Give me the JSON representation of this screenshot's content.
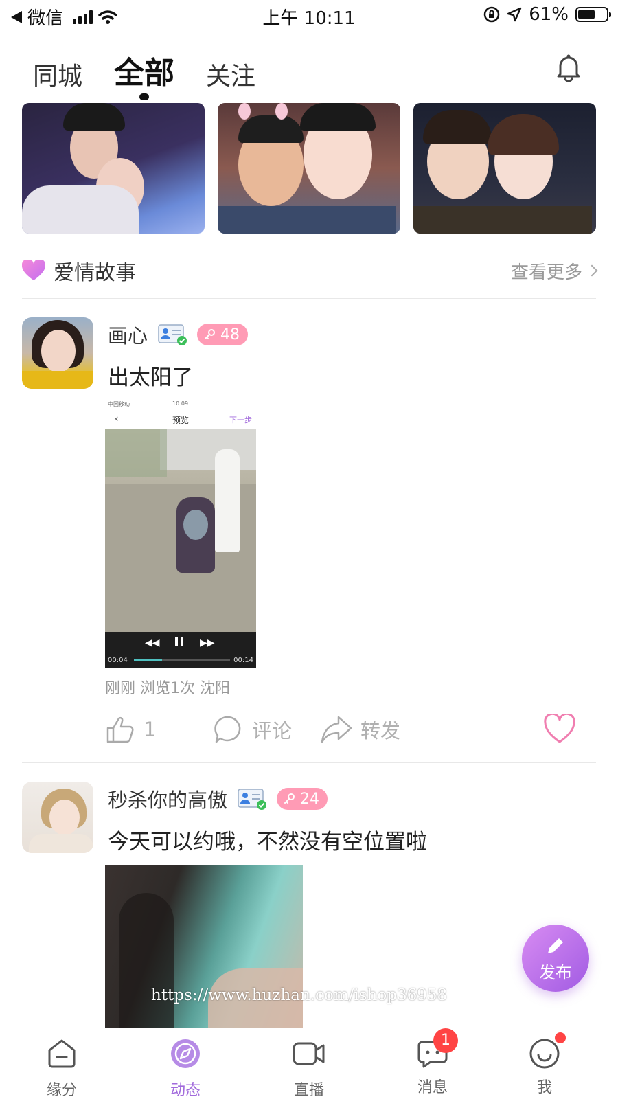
{
  "status_bar": {
    "back_app": "微信",
    "time": "上午 10:11",
    "battery_percent": "61%",
    "battery_level": 0.61
  },
  "tabs": [
    {
      "label": "同城",
      "active": false
    },
    {
      "label": "全部",
      "active": true
    },
    {
      "label": "关注",
      "active": false
    }
  ],
  "love_section": {
    "title": "爱情故事",
    "more_label": "查看更多"
  },
  "posts": [
    {
      "name": "画心",
      "level": "48",
      "text": "出太阳了",
      "video": {
        "title": "预览",
        "next": "下一步",
        "carrier": "中国移动",
        "clock": "10:09",
        "elapsed": "00:04",
        "duration": "00:14",
        "progress": 0.29
      },
      "meta": "刚刚 浏览1次 沈阳",
      "like_count": "1",
      "comment_label": "评论",
      "share_label": "转发"
    },
    {
      "name": "秒杀你的高傲",
      "level": "24",
      "text": "今天可以约哦，不然没有空位置啦"
    }
  ],
  "fab": {
    "label": "发布"
  },
  "watermark": "https://www.huzhan.com/ishop36958",
  "bottom_nav": [
    {
      "label": "缘分",
      "icon": "home-icon",
      "active": false
    },
    {
      "label": "动态",
      "icon": "compass-icon",
      "active": true
    },
    {
      "label": "直播",
      "icon": "video-camera-icon",
      "active": false
    },
    {
      "label": "消息",
      "icon": "chat-icon",
      "active": false,
      "badge": "1"
    },
    {
      "label": "我",
      "icon": "smile-icon",
      "active": false
    }
  ],
  "colors": {
    "accent": "#a26bdc",
    "badge_pink": "#ff9bb5",
    "alert_red": "#ff4444"
  }
}
